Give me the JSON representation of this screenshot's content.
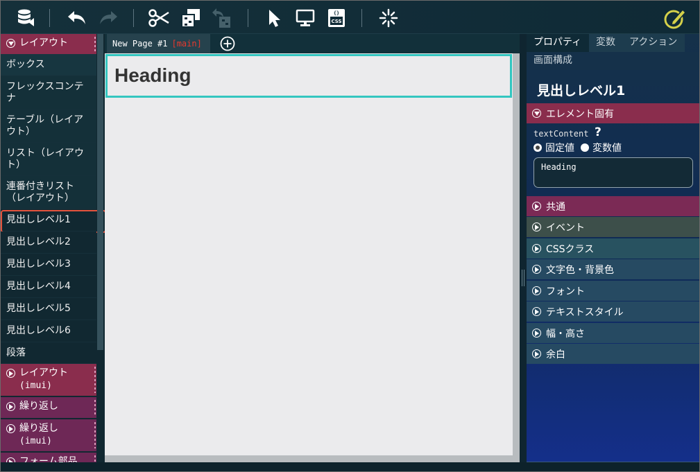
{
  "toolbar": {
    "buttons": [
      {
        "name": "database-icon"
      },
      {
        "name": "undo-icon"
      },
      {
        "name": "redo-icon"
      },
      {
        "name": "cut-icon"
      },
      {
        "name": "copy-element-icon"
      },
      {
        "name": "paste-element-icon"
      },
      {
        "name": "pointer-icon"
      },
      {
        "name": "monitor-icon"
      },
      {
        "name": "css-icon",
        "label": "CSS"
      },
      {
        "name": "sparkle-icon"
      },
      {
        "name": "edit-icon"
      }
    ]
  },
  "palette": {
    "category_layout": "レイアウト",
    "items": [
      "ボックス",
      "フレックスコンテナ",
      "テーブル（レイアウト）",
      "リスト（レイアウト）",
      "連番付きリスト（レイアウト）",
      "見出しレベル1",
      "見出しレベル2",
      "見出しレベル3",
      "見出しレベル4",
      "見出しレベル5",
      "見出しレベル6",
      "段落"
    ],
    "selected_item": "見出しレベル1",
    "categories_bottom": [
      {
        "label": "レイアウト",
        "sub": "(imui)"
      },
      {
        "label": "繰り返し",
        "sub": ""
      },
      {
        "label": "繰り返し",
        "sub": "(imui)"
      },
      {
        "label": "フォーム部品",
        "sub": ""
      }
    ]
  },
  "editor": {
    "tab_title": "New Page #1",
    "tab_branch": "[main]",
    "heading_text": "Heading"
  },
  "properties": {
    "tabs": [
      "プロパティ",
      "変数",
      "アクション",
      "画面構成"
    ],
    "active_tab": "プロパティ",
    "element_title": "見出しレベル1",
    "sections": [
      "エレメント固有",
      "共通",
      "イベント",
      "CSSクラス",
      "文字色・背景色",
      "フォント",
      "テキストスタイル",
      "幅・高さ",
      "余白"
    ],
    "field_name": "textContent",
    "help_mark": "?",
    "radio_fixed": "固定値",
    "radio_variable": "変数値",
    "field_value": "Heading",
    "colors": {
      "layout_category": "#8a2d4d",
      "common": "#7b2a55",
      "event": "#3d4f4a",
      "css_class": "#285260",
      "default_section": "#264a62",
      "highlight": "#e5533d",
      "selection_border": "#33c6c0"
    }
  }
}
